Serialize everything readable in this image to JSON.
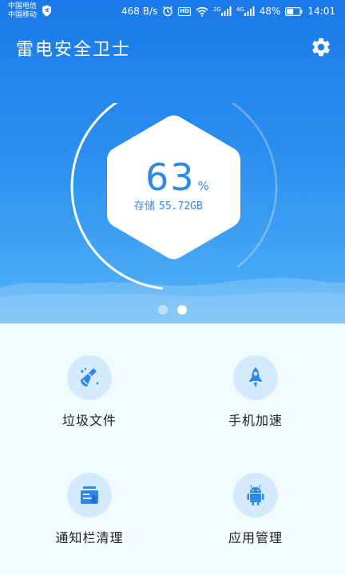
{
  "status_bar": {
    "carrier_1": "中国电信",
    "carrier_2": "中国移动",
    "net_speed": "468 B/s",
    "hd": "HD",
    "net_gen_1": "2G",
    "net_gen_2": "4G",
    "battery": "48%",
    "time": "14:01"
  },
  "app": {
    "title": "雷电安全卫士"
  },
  "gauge": {
    "percent_value": "63",
    "percent_sign": "%",
    "storage_label": "存储",
    "storage_value": "55.72GB",
    "progress_fraction": 0.63
  },
  "pager": {
    "count": 2,
    "active_index": 1
  },
  "features": [
    {
      "label": "垃圾文件",
      "icon": "broom-icon"
    },
    {
      "label": "手机加速",
      "icon": "rocket-icon"
    },
    {
      "label": "通知栏清理",
      "icon": "notification-card-icon"
    },
    {
      "label": "应用管理",
      "icon": "android-icon"
    }
  ],
  "colors": {
    "hero_top": "#1a79e8",
    "hero_bottom": "#55b3f8",
    "accent": "#2f87e6",
    "icon_circle": "#d3ebfc",
    "page_background": "#f2fbfe"
  }
}
